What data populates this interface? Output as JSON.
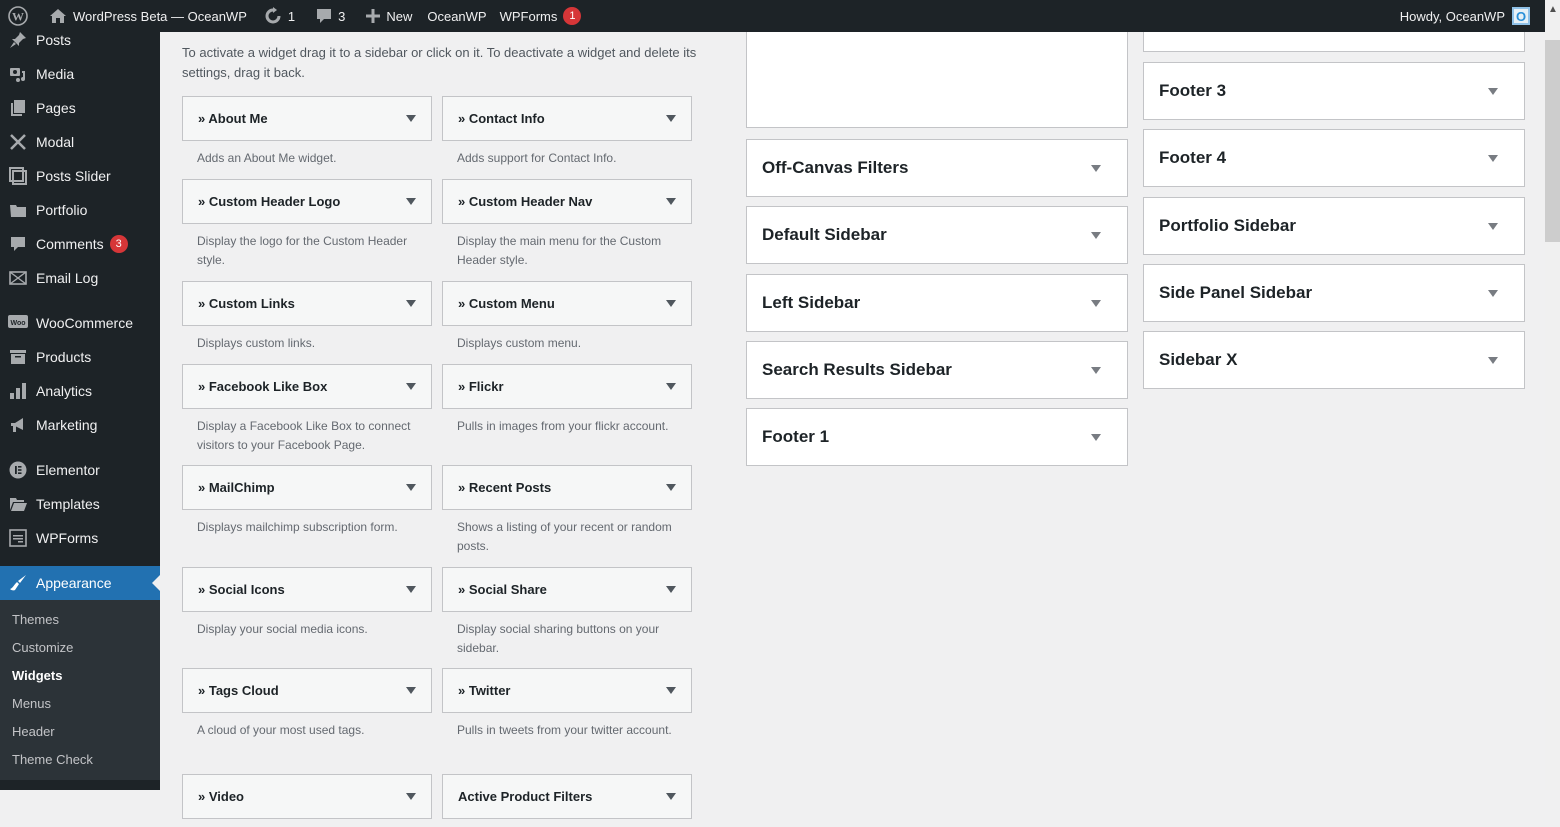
{
  "adminbar": {
    "site_name": "WordPress Beta — OceanWP",
    "updates_count": "1",
    "comments_count": "3",
    "new_label": "New",
    "oceanwp_label": "OceanWP",
    "wpforms_label": "WPForms",
    "wpforms_badge": "1",
    "howdy": "Howdy, OceanWP",
    "avatar_letter": "O"
  },
  "menu": {
    "items": [
      {
        "label": "Posts",
        "icon": "pin-icon"
      },
      {
        "label": "Media",
        "icon": "media-icon"
      },
      {
        "label": "Pages",
        "icon": "pages-icon"
      },
      {
        "label": "Modal",
        "icon": "modal-icon"
      },
      {
        "label": "Posts Slider",
        "icon": "slider-icon"
      },
      {
        "label": "Portfolio",
        "icon": "folder-icon"
      },
      {
        "label": "Comments",
        "icon": "comment-icon",
        "badge": "3"
      },
      {
        "label": "Email Log",
        "icon": "email-icon"
      },
      {
        "label": "WooCommerce",
        "icon": "woo-icon"
      },
      {
        "label": "Products",
        "icon": "archive-icon"
      },
      {
        "label": "Analytics",
        "icon": "chart-icon"
      },
      {
        "label": "Marketing",
        "icon": "megaphone-icon"
      },
      {
        "label": "Elementor",
        "icon": "elementor-icon"
      },
      {
        "label": "Templates",
        "icon": "folder-open-icon"
      },
      {
        "label": "WPForms",
        "icon": "form-icon"
      },
      {
        "label": "Appearance",
        "icon": "paintbrush-icon"
      }
    ],
    "submenu": [
      "Themes",
      "Customize",
      "Widgets",
      "Menus",
      "Header",
      "Theme Check"
    ]
  },
  "intro": "To activate a widget drag it to a sidebar or click on it. To deactivate a widget and delete its settings, drag it back.",
  "available_widgets": [
    {
      "title": "» About Me",
      "desc": "Adds an About Me widget."
    },
    {
      "title": "» Contact Info",
      "desc": "Adds support for Contact Info."
    },
    {
      "title": "» Custom Header Logo",
      "desc": "Display the logo for the Custom Header style."
    },
    {
      "title": "» Custom Header Nav",
      "desc": "Display the main menu for the Custom Header style."
    },
    {
      "title": "» Custom Links",
      "desc": "Displays custom links."
    },
    {
      "title": "» Custom Menu",
      "desc": "Displays custom menu."
    },
    {
      "title": "» Facebook Like Box",
      "desc": "Display a Facebook Like Box to connect visitors to your Facebook Page."
    },
    {
      "title": "» Flickr",
      "desc": "Pulls in images from your flickr account."
    },
    {
      "title": "» MailChimp",
      "desc": "Displays mailchimp subscription form."
    },
    {
      "title": "» Recent Posts",
      "desc": "Shows a listing of your recent or random posts."
    },
    {
      "title": "» Social Icons",
      "desc": "Display your social media icons."
    },
    {
      "title": "» Social Share",
      "desc": "Display social sharing buttons on your sidebar."
    },
    {
      "title": "» Tags Cloud",
      "desc": "A cloud of your most used tags."
    },
    {
      "title": "» Twitter",
      "desc": "Pulls in tweets from your twitter account."
    },
    {
      "title": "» Video",
      "desc": ""
    },
    {
      "title": "Active Product Filters",
      "desc": ""
    }
  ],
  "sidebars_col1": [
    "Off-Canvas Filters",
    "Default Sidebar",
    "Left Sidebar",
    "Search Results Sidebar",
    "Footer 1"
  ],
  "sidebars_col2": [
    "Footer 3",
    "Footer 4",
    "Portfolio Sidebar",
    "Side Panel Sidebar",
    "Sidebar X"
  ]
}
